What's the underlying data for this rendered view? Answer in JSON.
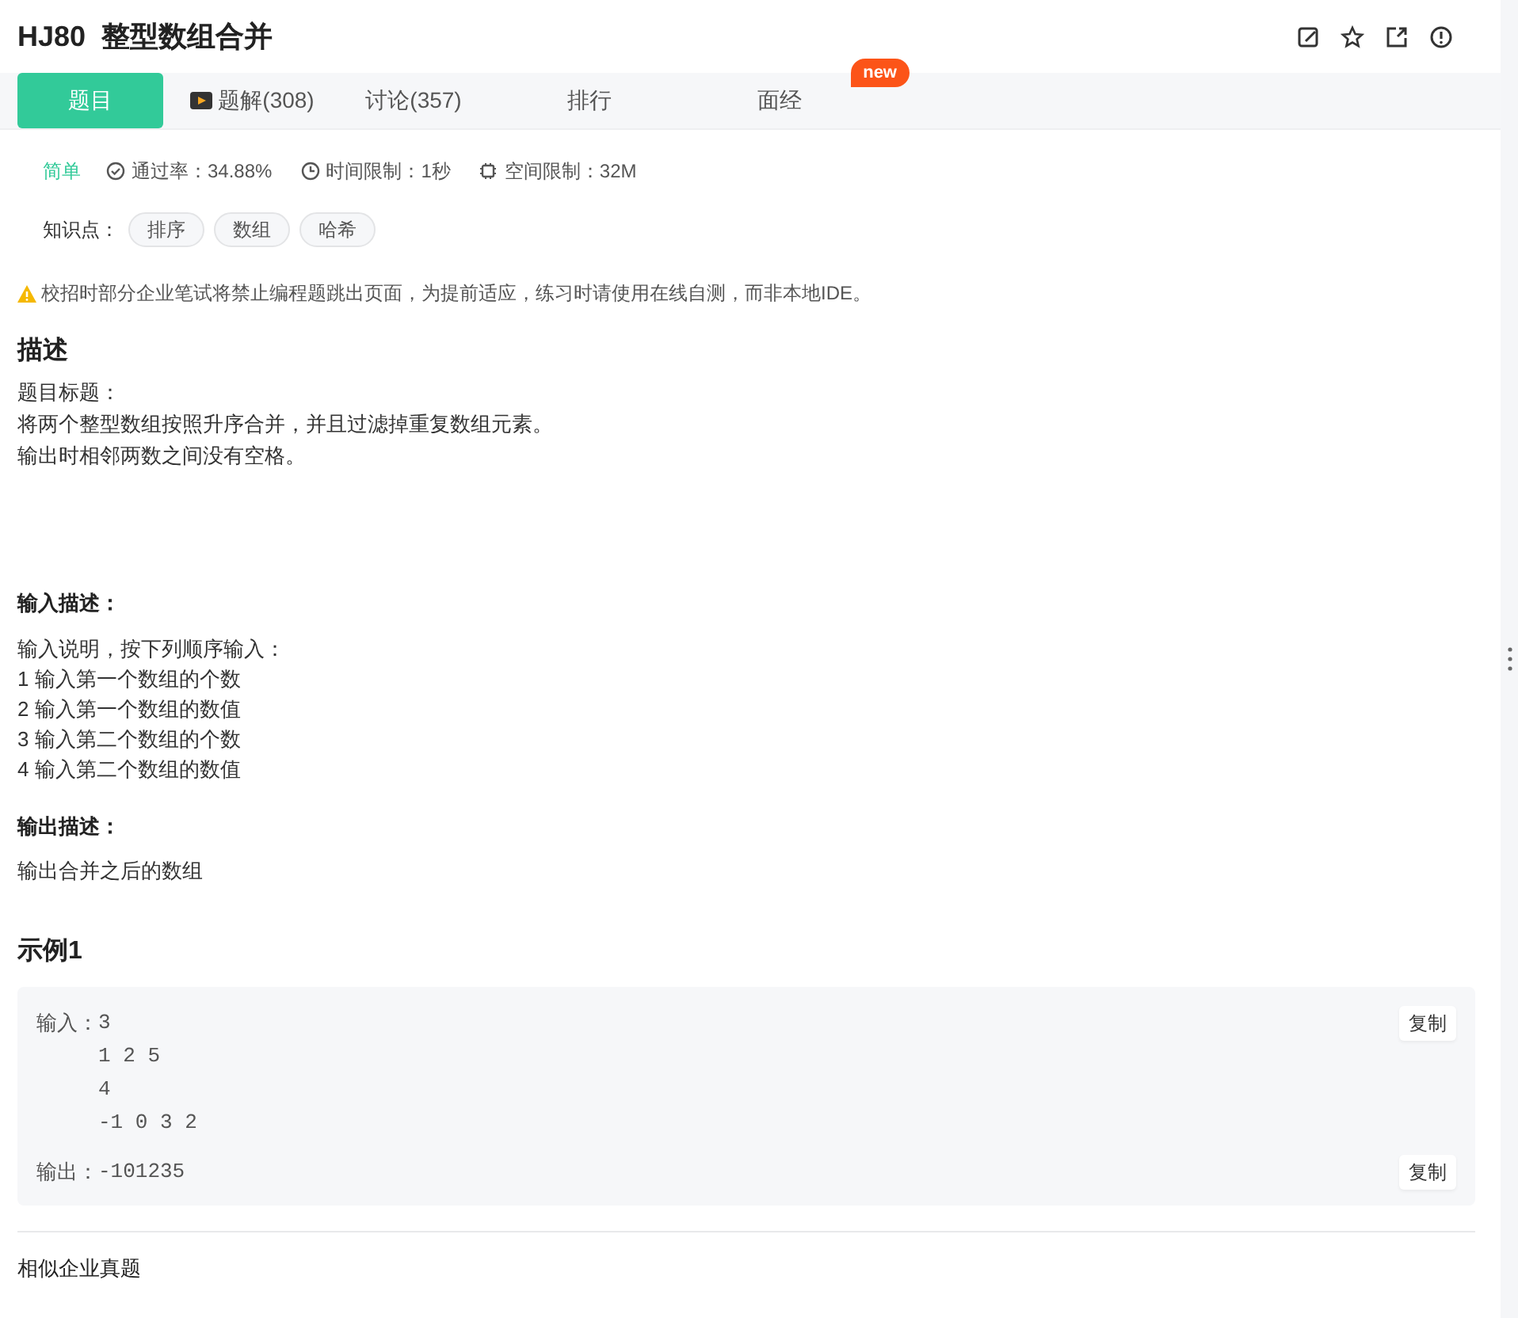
{
  "title": "HJ80  整型数组合并",
  "tabs": [
    {
      "label": "题目",
      "selected": true
    },
    {
      "label": "题解(308)",
      "selected": false,
      "kind": "video"
    },
    {
      "label": "讨论(357)",
      "selected": false
    },
    {
      "label": "排行",
      "selected": false
    },
    {
      "label": "面经",
      "selected": false,
      "badge": "new"
    }
  ],
  "meta": {
    "difficulty": "简单",
    "stats": [
      {
        "kind": "pass",
        "text": "通过率：34.88%"
      },
      {
        "kind": "time",
        "text": "时间限制：1秒"
      },
      {
        "kind": "memory",
        "text": "空间限制：32M"
      }
    ]
  },
  "knowledge": {
    "label": "知识点：",
    "tags": [
      "排序",
      "数组",
      "哈希"
    ]
  },
  "notice": "校招时部分企业笔试将禁止编程题跳出页面，为提前适应，练习时请使用在线自测，而非本地IDE。",
  "description": {
    "heading": "描述",
    "lines": [
      "题目标题：",
      "将两个整型数组按照升序合并，并且过滤掉重复数组元素。",
      "输出时相邻两数之间没有空格。"
    ]
  },
  "input_description": {
    "heading": "输入描述：",
    "lines": [
      "输入说明，按下列顺序输入：",
      "1 输入第一个数组的个数",
      "2 输入第一个数组的数值",
      "3 输入第二个数组的个数",
      "4 输入第二个数组的数值"
    ]
  },
  "output_description": {
    "heading": "输出描述：",
    "lines": [
      "输出合并之后的数组"
    ]
  },
  "example": {
    "heading": "示例1",
    "blocks": [
      {
        "label": "输入：",
        "lines": [
          "3",
          "1 2 5",
          "4",
          "-1 0 3 2"
        ],
        "copy": "复制"
      },
      {
        "label": "输出：",
        "lines": [
          "-101235"
        ],
        "copy": "复制"
      }
    ]
  },
  "similar": {
    "heading": "相似企业真题"
  }
}
